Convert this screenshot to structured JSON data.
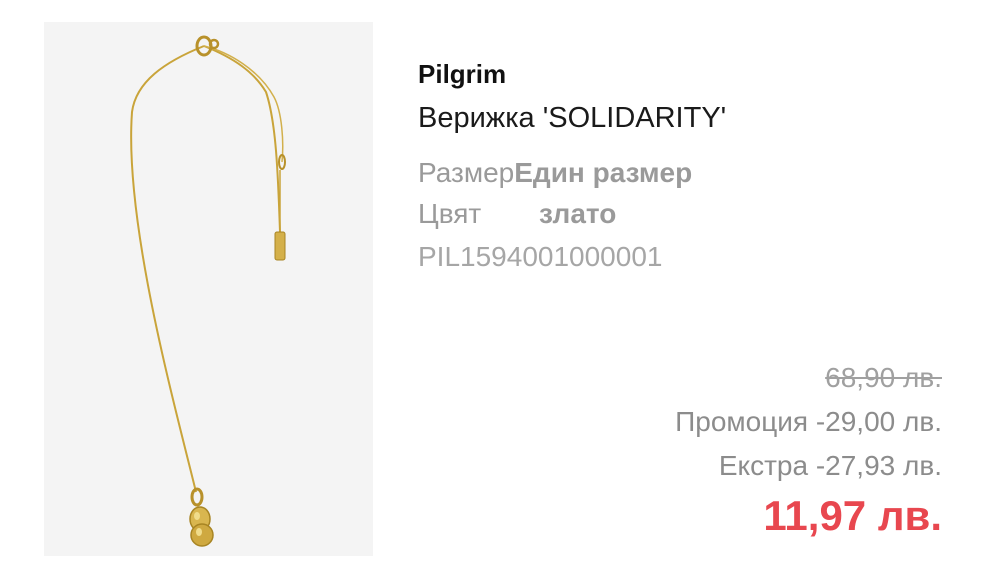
{
  "product": {
    "brand": "Pilgrim",
    "title": "Верижка 'SOLIDARITY'",
    "size_label": "Размер",
    "size_value": "Един размер",
    "color_label": "Цвят",
    "color_value": "злато",
    "sku": "PIL1594001000001",
    "image_icon": "gold-necklace-image"
  },
  "pricing": {
    "original_price": "68,90 лв.",
    "promo_line": "Промоция -29,00 лв.",
    "extra_line": "Екстра -27,93 лв.",
    "final_price": "11,97 лв."
  },
  "colors": {
    "final_price": "#e8474f",
    "gold": "#c9a43a",
    "image_background": "#f4f4f4",
    "muted_text": "#9a9a9a"
  }
}
